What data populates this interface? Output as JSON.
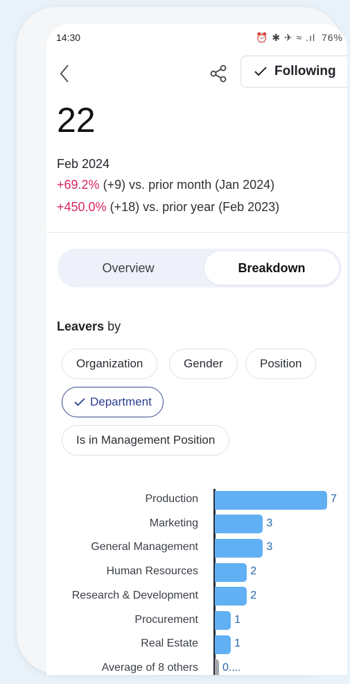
{
  "status_bar": {
    "time": "14:30",
    "icons": "⏰ ✱ ✈ ≈ .ıl",
    "battery": "76%"
  },
  "header": {
    "follow_label": "Following"
  },
  "metric": {
    "value": "22",
    "period": "Feb 2024",
    "comparisons": [
      {
        "delta": "+69.2%",
        "rest": " (+9) vs. prior month (Jan 2024)"
      },
      {
        "delta": "+450.0%",
        "rest": " (+18) vs. prior year (Feb 2023)"
      }
    ],
    "delta_color": "#d6265e"
  },
  "tabs": [
    {
      "label": "Overview",
      "active": false
    },
    {
      "label": "Breakdown",
      "active": true
    }
  ],
  "breakdown": {
    "title_bold": "Leavers",
    "title_rest": " by",
    "chips": [
      {
        "label": "Organization",
        "selected": false
      },
      {
        "label": "Gender",
        "selected": false
      },
      {
        "label": "Position",
        "selected": false
      },
      {
        "label": "Department",
        "selected": true
      },
      {
        "label": "Is in Management Position",
        "selected": false
      }
    ]
  },
  "chart_data": {
    "type": "bar",
    "orientation": "horizontal",
    "categories": [
      "Production",
      "Marketing",
      "General Management",
      "Human Resources",
      "Research & Development",
      "Procurement",
      "Real Estate",
      "Average of 8 others"
    ],
    "values": [
      7,
      3,
      3,
      2,
      2,
      1,
      1,
      0.125
    ],
    "value_labels": [
      "7",
      "3",
      "3",
      "2",
      "2",
      "1",
      "1",
      "0...."
    ],
    "bar_color": "#62b0f4",
    "other_bar_color": "#a3a7ad",
    "value_label_color": "#2767a8",
    "xlim": [
      0,
      7
    ]
  }
}
